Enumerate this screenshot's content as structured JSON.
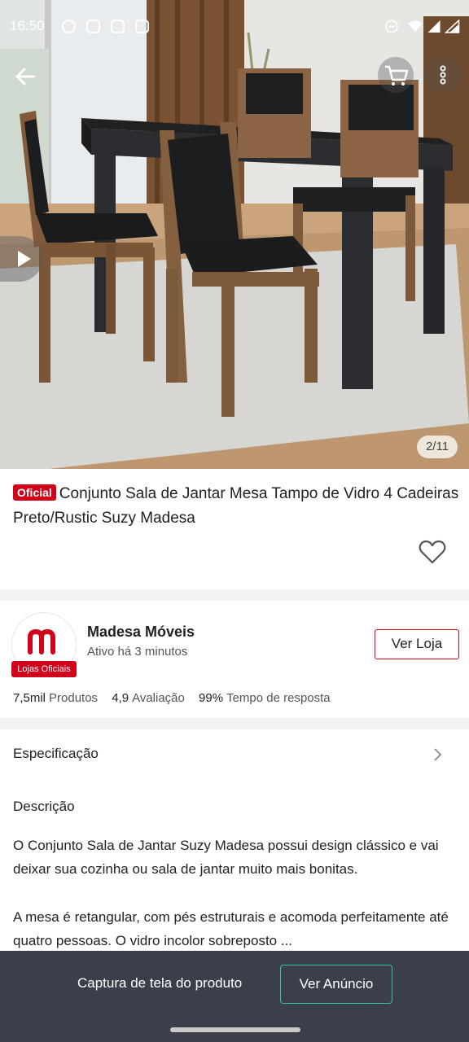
{
  "status_bar": {
    "time": "16:50",
    "left_icons": [
      "whatsapp-icon",
      "instagram-icon",
      "instagram-icon",
      "instagram-icon"
    ],
    "right_icons": [
      "do-not-disturb-icon",
      "wifi-icon",
      "signal-icon",
      "battery-icon"
    ]
  },
  "gallery": {
    "counter": "2/11",
    "buttons": [
      "back-arrow-icon",
      "cart-icon",
      "more-vertical-icon",
      "play-icon"
    ]
  },
  "product": {
    "badge": "Oficial",
    "title": "Conjunto Sala de Jantar Mesa Tampo de Vidro 4 Cadeiras Preto/Rustic Suzy Madesa"
  },
  "shop": {
    "name": "Madesa Móveis",
    "active": "Ativo há 3 minutos",
    "logo_label": "Lojas Oficiais",
    "button": "Ver Loja",
    "stats": [
      {
        "value": "7,5mil",
        "label": "Produtos"
      },
      {
        "value": "4,9",
        "label": "Avaliação"
      },
      {
        "value": "99%",
        "label": "Tempo de resposta"
      }
    ]
  },
  "specification": {
    "label": "Especificação"
  },
  "description": {
    "title": "Descrição",
    "p1": "O Conjunto Sala de Jantar Suzy Madesa possui design clássico e vai deixar sua cozinha ou sala de jantar muito mais bonitas.",
    "p2": "A mesa é retangular, com pés estruturais e acomoda perfeitamente até quatro pessoas. O vidro incolor sobreposto ..."
  },
  "bottom_bar": {
    "label": "Captura de tela do produto",
    "button": "Ver Anúncio"
  },
  "colors": {
    "brand_red": "#d0011b",
    "bottom_bar": "#3b3f4a",
    "accent_teal": "#3bbfb0"
  }
}
